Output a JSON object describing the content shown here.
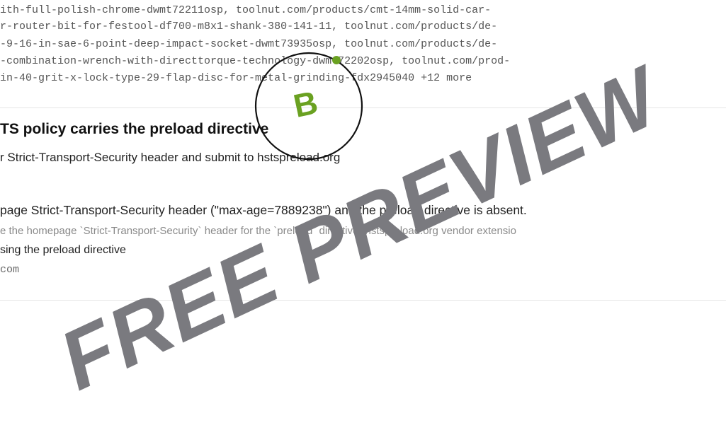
{
  "url_list": {
    "lines": [
      "ith-full-polish-chrome-dwmt72211osp, toolnut.com/products/cmt-14mm-solid-car-",
      "r-router-bit-for-festool-df700-m8x1-shank-380-141-11, toolnut.com/products/de-",
      "-9-16-in-sae-6-point-deep-impact-socket-dwmt73935osp, toolnut.com/products/de-",
      "-combination-wrench-with-directtorque-technology-dwmt72202osp, toolnut.com/prod-",
      "in-40-grit-x-lock-type-29-flap-disc-for-metal-grinding-fdx2945040 +12 more"
    ]
  },
  "finding": {
    "title": "TS policy carries the preload directive",
    "description": "r Strict-Transport-Security header and submit to hstspreload.org",
    "result": "page Strict-Transport-Security header (\"max-age=7889238\") and the preload directive is absent.",
    "check": "e the homepage `Strict-Transport-Security` header for the `preload` directive (hstspreload.org vendor extensio",
    "fix": "sing the preload directive",
    "source": "com"
  },
  "badge": {
    "letter": "B",
    "color": "#6aa121"
  },
  "watermark": {
    "text": "FREE PREVIEW",
    "color": "#7a7a7f"
  }
}
